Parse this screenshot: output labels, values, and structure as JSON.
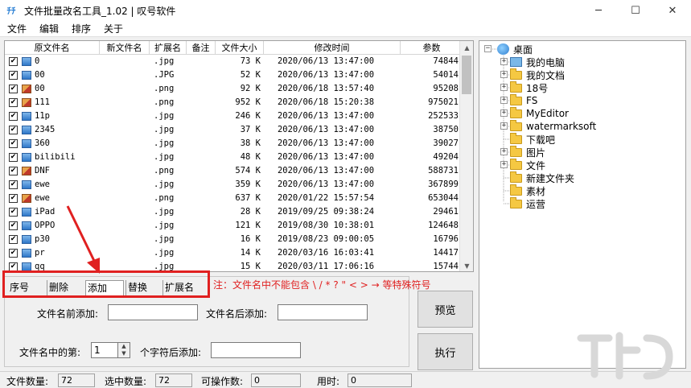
{
  "window": {
    "title": "文件批量改名工具_1.02 | 叹号软件",
    "app_icon_glyph": "ﾁﾁ",
    "minimize": "─",
    "maximize": "☐",
    "close": "✕"
  },
  "menu": [
    "文件",
    "编辑",
    "排序",
    "关于"
  ],
  "file_list": {
    "headers": [
      "原文件名",
      "新文件名",
      "扩展名",
      "备注",
      "文件大小",
      "修改时间",
      "参数"
    ],
    "rows": [
      {
        "name": "0",
        "ext": ".jpg",
        "size": "73 K",
        "time": "2020/06/13 13:47:00",
        "param": "74844",
        "type": "jpg"
      },
      {
        "name": "00",
        "ext": ".JPG",
        "size": "52 K",
        "time": "2020/06/13 13:47:00",
        "param": "54014",
        "type": "jpg"
      },
      {
        "name": "00",
        "ext": ".png",
        "size": "92 K",
        "time": "2020/06/18 13:57:40",
        "param": "95208",
        "type": "png"
      },
      {
        "name": "111",
        "ext": ".png",
        "size": "952 K",
        "time": "2020/06/18 15:20:38",
        "param": "975021",
        "type": "png"
      },
      {
        "name": "11p",
        "ext": ".jpg",
        "size": "246 K",
        "time": "2020/06/13 13:47:00",
        "param": "252533",
        "type": "jpg"
      },
      {
        "name": "2345",
        "ext": ".jpg",
        "size": "37 K",
        "time": "2020/06/13 13:47:00",
        "param": "38750",
        "type": "jpg"
      },
      {
        "name": "360",
        "ext": ".jpg",
        "size": "38 K",
        "time": "2020/06/13 13:47:00",
        "param": "39027",
        "type": "jpg"
      },
      {
        "name": "bilibili",
        "ext": ".jpg",
        "size": "48 K",
        "time": "2020/06/13 13:47:00",
        "param": "49204",
        "type": "jpg"
      },
      {
        "name": "DNF",
        "ext": ".png",
        "size": "574 K",
        "time": "2020/06/13 13:47:00",
        "param": "588731",
        "type": "png"
      },
      {
        "name": "ewe",
        "ext": ".jpg",
        "size": "359 K",
        "time": "2020/06/13 13:47:00",
        "param": "367899",
        "type": "jpg"
      },
      {
        "name": "ewe",
        "ext": ".png",
        "size": "637 K",
        "time": "2020/01/22 15:57:54",
        "param": "653044",
        "type": "png"
      },
      {
        "name": "iPad",
        "ext": ".jpg",
        "size": "28 K",
        "time": "2019/09/25 09:38:24",
        "param": "29461",
        "type": "jpg"
      },
      {
        "name": "OPPO",
        "ext": ".jpg",
        "size": "121 K",
        "time": "2019/08/30 10:38:01",
        "param": "124648",
        "type": "jpg"
      },
      {
        "name": "p30",
        "ext": ".jpg",
        "size": "16 K",
        "time": "2019/08/23 09:00:05",
        "param": "16796",
        "type": "jpg"
      },
      {
        "name": "pr",
        "ext": ".jpg",
        "size": "14 K",
        "time": "2020/03/16 16:03:41",
        "param": "14417",
        "type": "jpg"
      },
      {
        "name": "qq",
        "ext": ".jpg",
        "size": "15 K",
        "time": "2020/03/11 17:06:16",
        "param": "15744",
        "type": "jpg"
      }
    ]
  },
  "tree": {
    "root": "桌面",
    "items": [
      "我的电脑",
      "我的文档",
      "18号",
      "FS",
      "MyEditor",
      "watermarksoft",
      "下载吧",
      "图片",
      "文件",
      "新建文件夹",
      "素材",
      "运营"
    ]
  },
  "tabs": [
    "序号",
    "删除",
    "添加",
    "替换",
    "扩展名"
  ],
  "active_tab": "添加",
  "warning": "注：文件名中不能包含 \\ /  * ? \" < > → 等特殊符号",
  "options": {
    "prefix_label": "文件名前添加:",
    "suffix_label": "文件名后添加:",
    "nth_label": "文件名中的第:",
    "nth_value": "1",
    "after_char_label": "个字符后添加:",
    "prefix_value": "",
    "suffix_value": "",
    "after_char_value": ""
  },
  "buttons": {
    "preview": "预览",
    "execute": "执行"
  },
  "status": {
    "file_count_label": "文件数量:",
    "file_count": "72",
    "selected_label": "选中数量:",
    "selected": "72",
    "operable_label": "可操作数:",
    "operable": "0",
    "time_label": "用时:",
    "time": "0"
  },
  "colors": {
    "accent_red": "#e02020",
    "folder": "#f5c842"
  }
}
